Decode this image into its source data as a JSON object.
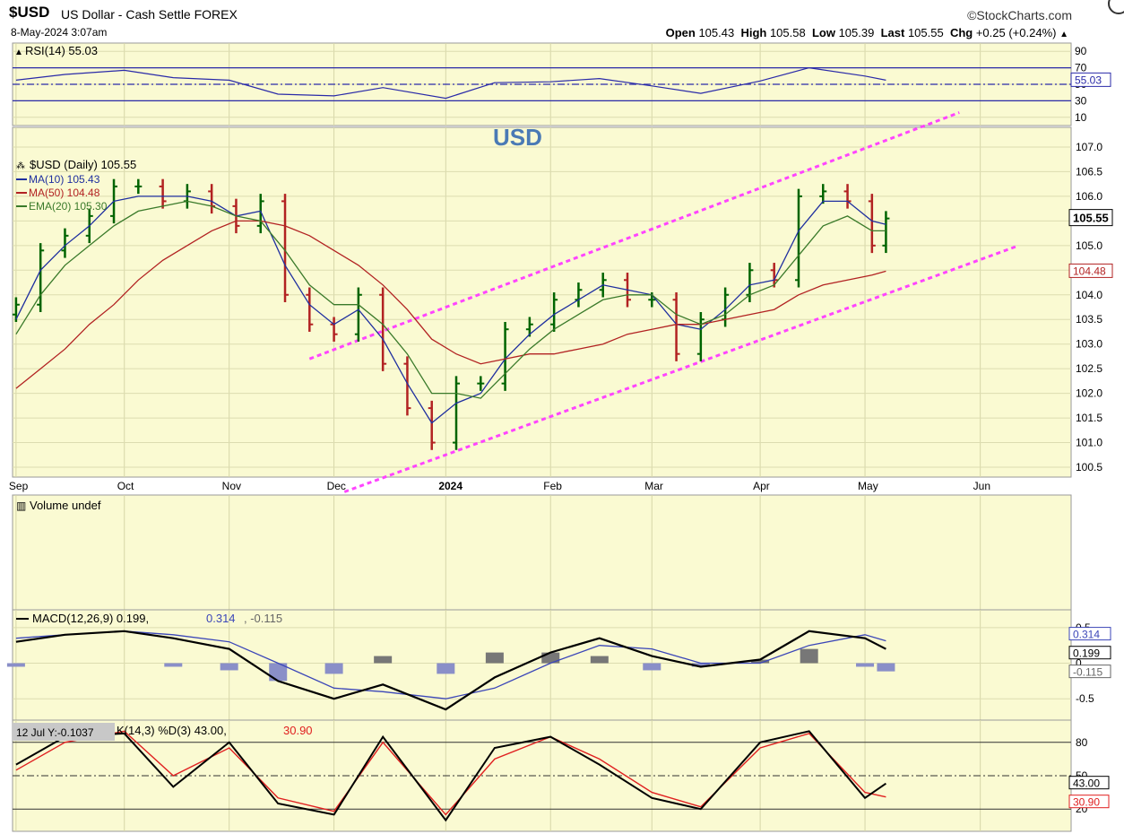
{
  "header": {
    "symbol": "$USD",
    "name": "US Dollar - Cash Settle FOREX",
    "datetime": "8-May-2024 3:07am",
    "brand": "StockCharts.com",
    "open_label": "Open",
    "open": "105.43",
    "high_label": "High",
    "high": "105.58",
    "low_label": "Low",
    "low": "105.39",
    "last_label": "Last",
    "last": "105.55",
    "chg_label": "Chg",
    "chg": "+0.25 (+0.24%)"
  },
  "colors": {
    "panel_bg": "#fafad2",
    "up": "#006400",
    "down": "#b22222",
    "ma10": "#1f2f9f",
    "ma50": "#b22222",
    "ema20": "#3a7a2a",
    "channel": "#ff44ff",
    "rsi": "#2a2aa8",
    "annot": "#4a7ab5"
  },
  "chart_data": [
    {
      "type": "line",
      "panel": "rsi",
      "title": "RSI(14) 55.03",
      "y_ticks": [
        90,
        70,
        50,
        30,
        10
      ],
      "ylim": [
        0,
        100
      ],
      "ref_lines": [
        70,
        50,
        30
      ],
      "last_value": 55.03,
      "last_label": "55.03",
      "series": [
        {
          "name": "RSI(14)",
          "x": [
            "2023-09-01",
            "2023-09-15",
            "2023-10-02",
            "2023-10-16",
            "2023-11-01",
            "2023-11-15",
            "2023-12-01",
            "2023-12-15",
            "2024-01-02",
            "2024-01-16",
            "2024-02-01",
            "2024-02-15",
            "2024-03-01",
            "2024-03-15",
            "2024-04-01",
            "2024-04-15",
            "2024-05-01",
            "2024-05-07"
          ],
          "values": [
            55,
            62,
            67,
            58,
            55,
            38,
            36,
            46,
            33,
            52,
            53,
            57,
            48,
            39,
            54,
            70,
            60,
            55
          ]
        }
      ]
    },
    {
      "type": "candlestick",
      "panel": "price",
      "title": "$USD (Daily) 105.55",
      "annotation": "USD",
      "x_ticks": [
        "Sep",
        "Oct",
        "Nov",
        "Dec",
        "2024",
        "Feb",
        "Mar",
        "Apr",
        "May",
        "Jun"
      ],
      "y_ticks": [
        107.0,
        106.5,
        106.0,
        105.5,
        105.0,
        104.5,
        104.0,
        103.5,
        103.0,
        102.5,
        102.0,
        101.5,
        101.0,
        100.5
      ],
      "ylim": [
        100.3,
        107.4
      ],
      "legend": [
        "MA(10) 105.43",
        "MA(50) 104.48",
        "EMA(20) 105.30"
      ],
      "price_tags": [
        "105.55",
        "104.48"
      ],
      "closes": {
        "x": [
          "2023-09-01",
          "2023-09-08",
          "2023-09-15",
          "2023-09-22",
          "2023-09-29",
          "2023-10-06",
          "2023-10-13",
          "2023-10-20",
          "2023-10-27",
          "2023-11-03",
          "2023-11-10",
          "2023-11-17",
          "2023-11-24",
          "2023-12-01",
          "2023-12-08",
          "2023-12-15",
          "2023-12-22",
          "2023-12-29",
          "2024-01-05",
          "2024-01-12",
          "2024-01-19",
          "2024-01-26",
          "2024-02-02",
          "2024-02-09",
          "2024-02-16",
          "2024-02-23",
          "2024-03-01",
          "2024-03-08",
          "2024-03-15",
          "2024-03-22",
          "2024-03-29",
          "2024-04-05",
          "2024-04-12",
          "2024-04-19",
          "2024-04-26",
          "2024-05-03",
          "2024-05-07"
        ],
        "values": [
          103.8,
          104.9,
          105.2,
          105.6,
          106.2,
          106.2,
          105.9,
          106.1,
          105.8,
          105.4,
          105.9,
          104.0,
          103.4,
          103.2,
          104.0,
          102.6,
          101.7,
          101.0,
          102.2,
          102.2,
          103.3,
          103.4,
          103.9,
          104.1,
          104.3,
          103.9,
          103.9,
          102.8,
          103.5,
          104.0,
          104.5,
          104.3,
          106.0,
          106.1,
          105.9,
          105.0,
          105.55
        ]
      },
      "series": [
        {
          "name": "MA(10)",
          "values": [
            103.5,
            104.5,
            105.0,
            105.4,
            105.9,
            106.0,
            106.0,
            106.0,
            105.9,
            105.6,
            105.7,
            104.6,
            103.8,
            103.4,
            103.7,
            103.1,
            102.2,
            101.4,
            101.8,
            102.0,
            102.7,
            103.2,
            103.6,
            103.9,
            104.2,
            104.1,
            104.0,
            103.4,
            103.3,
            103.7,
            104.2,
            104.3,
            105.3,
            105.9,
            105.9,
            105.5,
            105.43
          ]
        },
        {
          "name": "MA(50)",
          "values": [
            102.1,
            102.5,
            102.9,
            103.4,
            103.8,
            104.3,
            104.7,
            105.0,
            105.3,
            105.5,
            105.5,
            105.4,
            105.2,
            104.9,
            104.6,
            104.2,
            103.7,
            103.1,
            102.8,
            102.6,
            102.7,
            102.8,
            102.8,
            102.9,
            103.0,
            103.2,
            103.3,
            103.4,
            103.4,
            103.5,
            103.6,
            103.7,
            104.0,
            104.2,
            104.3,
            104.4,
            104.48
          ]
        },
        {
          "name": "EMA(20)",
          "values": [
            103.2,
            104.0,
            104.6,
            105.0,
            105.4,
            105.7,
            105.8,
            105.9,
            105.8,
            105.6,
            105.5,
            104.9,
            104.2,
            103.8,
            103.8,
            103.4,
            102.8,
            102.0,
            102.0,
            101.9,
            102.4,
            102.9,
            103.3,
            103.6,
            103.9,
            104.0,
            104.0,
            103.6,
            103.4,
            103.6,
            104.0,
            104.2,
            104.8,
            105.4,
            105.6,
            105.3,
            105.3
          ]
        }
      ],
      "channel": {
        "upper": [
          {
            "x": "2023-11-24",
            "y": 102.7
          },
          {
            "x": "2024-05-28",
            "y": 107.7
          }
        ],
        "lower": [
          {
            "x": "2023-12-04",
            "y": 100.0
          },
          {
            "x": "2024-06-14",
            "y": 105.0
          }
        ]
      }
    },
    {
      "type": "bar",
      "panel": "volume",
      "title": "Volume undef",
      "values": []
    },
    {
      "type": "line",
      "panel": "macd",
      "title": "MACD(12,26,9)",
      "legend": [
        "0.199",
        "0.314",
        "-0.115"
      ],
      "y_ticks": [
        0.5,
        0.0,
        -0.5
      ],
      "ylim": [
        -0.8,
        0.75
      ],
      "labels_right": [
        "0.314",
        "0.199",
        "-0.115"
      ],
      "x": [
        "2023-09-01",
        "2023-09-15",
        "2023-10-02",
        "2023-10-16",
        "2023-11-01",
        "2023-11-15",
        "2023-12-01",
        "2023-12-15",
        "2024-01-02",
        "2024-01-16",
        "2024-02-01",
        "2024-02-15",
        "2024-03-01",
        "2024-03-15",
        "2024-04-01",
        "2024-04-15",
        "2024-05-01",
        "2024-05-07"
      ],
      "series": [
        {
          "name": "MACD",
          "values": [
            0.3,
            0.4,
            0.45,
            0.35,
            0.2,
            -0.25,
            -0.5,
            -0.3,
            -0.65,
            -0.2,
            0.15,
            0.35,
            0.1,
            -0.05,
            0.05,
            0.45,
            0.35,
            0.199
          ]
        },
        {
          "name": "Signal",
          "values": [
            0.35,
            0.4,
            0.45,
            0.4,
            0.3,
            0.0,
            -0.35,
            -0.4,
            -0.5,
            -0.35,
            0.0,
            0.25,
            0.2,
            0.0,
            0.0,
            0.25,
            0.4,
            0.314
          ]
        },
        {
          "name": "Histogram",
          "values": [
            -0.05,
            0.0,
            0.0,
            -0.05,
            -0.1,
            -0.25,
            -0.15,
            0.1,
            -0.15,
            0.15,
            0.15,
            0.1,
            -0.1,
            -0.05,
            0.05,
            0.2,
            -0.05,
            -0.115
          ]
        }
      ]
    },
    {
      "type": "line",
      "panel": "stochastic",
      "title": "K(14,3) %D(3) 43.00, 30.90",
      "title_prefix": "K(14,3) %D(3) 43.00,",
      "title_suffix": "30.90",
      "tooltip": "12 Jul Y:-0.1037",
      "y_ticks": [
        80,
        50,
        20
      ],
      "ylim": [
        0,
        100
      ],
      "labels_right": [
        "43.00",
        "30.90"
      ],
      "x": [
        "2023-09-01",
        "2023-09-15",
        "2023-10-02",
        "2023-10-16",
        "2023-11-01",
        "2023-11-15",
        "2023-12-01",
        "2023-12-15",
        "2024-01-02",
        "2024-01-16",
        "2024-02-01",
        "2024-02-15",
        "2024-03-01",
        "2024-03-15",
        "2024-04-01",
        "2024-04-15",
        "2024-05-01",
        "2024-05-07"
      ],
      "series": [
        {
          "name": "%K",
          "values": [
            60,
            85,
            88,
            40,
            80,
            25,
            15,
            85,
            10,
            75,
            85,
            60,
            30,
            20,
            80,
            90,
            30,
            43
          ]
        },
        {
          "name": "%D",
          "values": [
            55,
            80,
            90,
            50,
            75,
            30,
            18,
            80,
            15,
            65,
            85,
            65,
            35,
            22,
            75,
            88,
            35,
            30.9
          ]
        }
      ]
    }
  ]
}
